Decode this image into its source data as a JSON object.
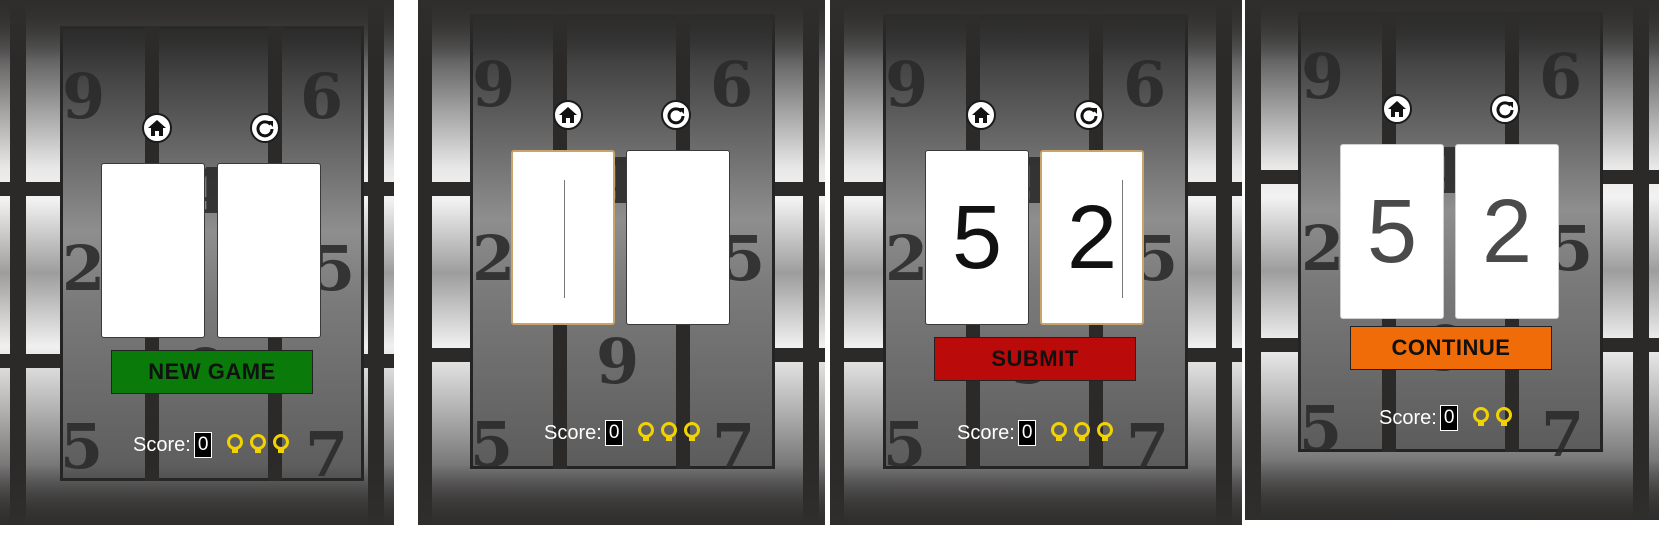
{
  "bg_numbers": [
    "9",
    "6",
    "4",
    "2",
    "5",
    "9",
    "5",
    "7"
  ],
  "nav": {
    "home_icon": "home-icon",
    "restart_icon": "restart-icon"
  },
  "colors": {
    "new_game": "#0a7a0a",
    "submit": "#bb0a0a",
    "continue": "#f06c08",
    "bulb": "#f2d200"
  },
  "panels": [
    {
      "state": "start",
      "card_left": "",
      "card_right": "",
      "action_label": "NEW GAME",
      "score_label": "Score:",
      "score_value": "0",
      "hints": 3
    },
    {
      "state": "input-empty",
      "card_left": "",
      "card_right": "",
      "action_label": "",
      "score_label": "Score:",
      "score_value": "0",
      "hints": 3
    },
    {
      "state": "input-filled",
      "card_left": "5",
      "card_right": "2",
      "action_label": "SUBMIT",
      "score_label": "Score:",
      "score_value": "0",
      "hints": 3
    },
    {
      "state": "result",
      "card_left": "5",
      "card_right": "2",
      "action_label": "CONTINUE",
      "score_label": "Score:",
      "score_value": "0",
      "hints": 2
    }
  ]
}
